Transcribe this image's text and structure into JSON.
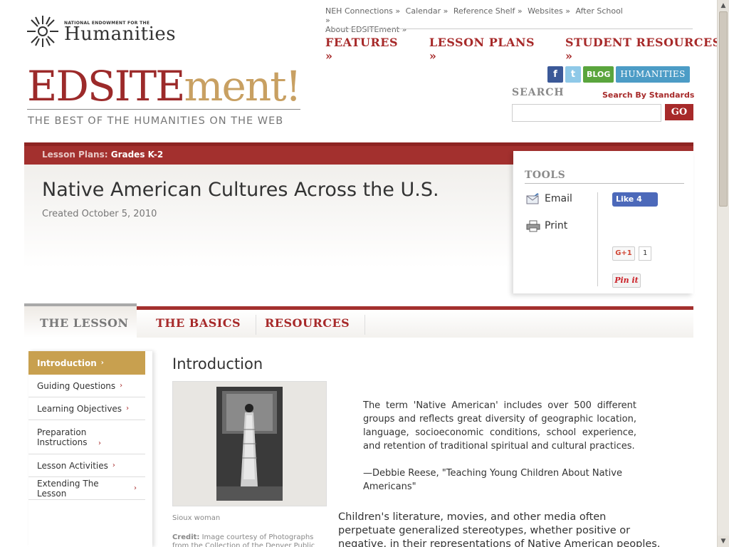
{
  "header": {
    "logo": {
      "small": "NATIONAL ENDOWMENT FOR THE",
      "big": "Humanities"
    },
    "top_links": [
      "NEH Connections »",
      "Calendar »",
      "Reference Shelf »",
      "Websites »",
      "After School »",
      "About EDSITEment »"
    ],
    "main_nav": [
      "FEATURES »",
      "LESSON PLANS »",
      "STUDENT RESOURCES »"
    ],
    "brand": {
      "part1": "EDSITE",
      "part2": "ment!"
    },
    "tagline": "THE BEST OF THE HUMANITIES ON THE WEB",
    "social": {
      "facebook": "f",
      "twitter": "t",
      "blog": "BLOG",
      "humanities": "HUMANITIES"
    },
    "search": {
      "label": "SEARCH",
      "standards_link": "Search By Standards",
      "placeholder": "",
      "go": "GO"
    }
  },
  "breadcrumb": {
    "prefix": "Lesson Plans:",
    "value": "Grades K-2"
  },
  "lesson": {
    "title": "Native American Cultures Across the U.S.",
    "created": "Created October 5, 2010"
  },
  "tools": {
    "title": "TOOLS",
    "email": "Email",
    "print": "Print",
    "fb_like": "Like 4",
    "gplus": "G+1",
    "gplus_count": "1",
    "pinit": "Pin it"
  },
  "tabs": {
    "active": "THE LESSON",
    "items": [
      "THE BASICS",
      "RESOURCES"
    ]
  },
  "sidebar": {
    "items": [
      {
        "label": "Introduction"
      },
      {
        "label": "Guiding Questions"
      },
      {
        "label": "Learning Objectives"
      },
      {
        "label": "Preparation Instructions"
      },
      {
        "label": "Lesson Activities"
      },
      {
        "label": "Extending The Lesson"
      }
    ],
    "chevron": "›"
  },
  "content": {
    "heading": "Introduction",
    "caption": "Sioux woman",
    "credit_label": "Credit:",
    "credit_text": "Image courtesy of Photographs from the Collection of the Denver Public",
    "quote": "The term 'Native American' includes over 500 different groups and reflects great diversity of geographic location, language, socioeconomic conditions, school experience, and retention of traditional spiritual and cultural practices.",
    "quote_source": "—Debbie Reese, \"Teaching Young Children About Native Americans\"",
    "body": "Children's literature, movies, and other media often perpetuate generalized stereotypes, whether positive or negative, in their representations of Native American peoples. Teaching children"
  },
  "colors": {
    "accent": "#a72a2a",
    "gold": "#c8a04f",
    "brand_gold": "#c8a062"
  }
}
